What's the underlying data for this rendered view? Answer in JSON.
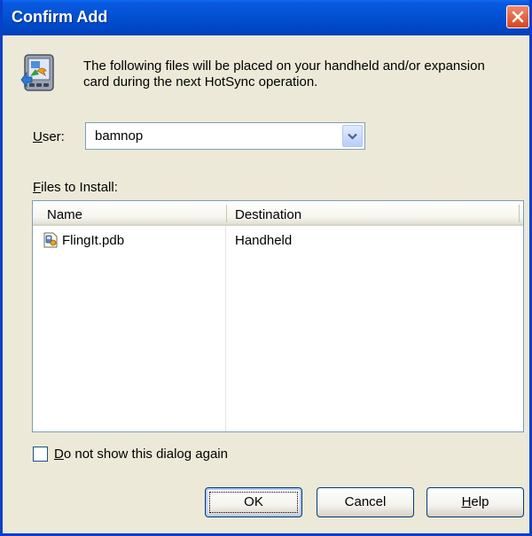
{
  "window": {
    "title": "Confirm Add"
  },
  "header": {
    "icon": "hotsync-install-icon",
    "message": "The following files will be placed on your handheld and/or expansion card during the next HotSync operation."
  },
  "user": {
    "label_mnemonic": "U",
    "label_rest": "ser:",
    "value": "bamnop"
  },
  "files": {
    "label_mnemonic": "F",
    "label_rest": "iles to Install:",
    "columns": [
      "Name",
      "Destination"
    ],
    "rows": [
      {
        "name": "FlingIt.pdb",
        "destination": "Handheld"
      }
    ]
  },
  "options": {
    "dont_show_mnemonic": "D",
    "dont_show_rest": "o not show this dialog again",
    "dont_show_checked": false
  },
  "buttons": {
    "ok": "OK",
    "cancel": "Cancel",
    "help_mnemonic": "H",
    "help_rest": "elp"
  },
  "colors": {
    "titlebar": "#0047c8",
    "dialog_bg": "#ece9d8",
    "close_button": "#d9451f"
  }
}
